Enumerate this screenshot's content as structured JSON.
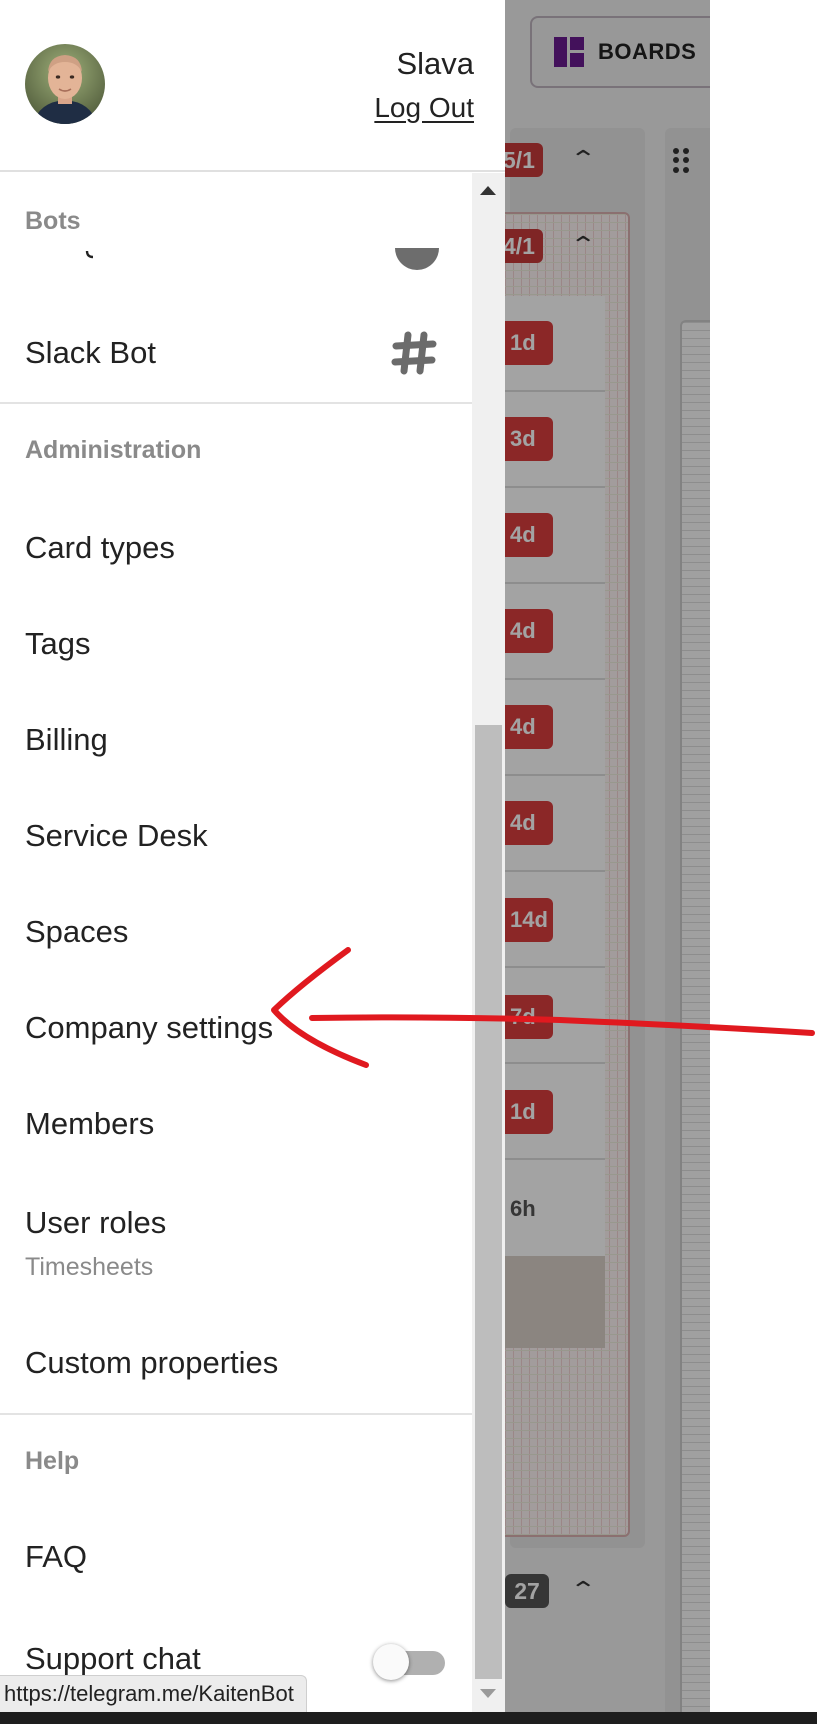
{
  "drawer": {
    "user_name": "Slava",
    "logout_label": "Log Out",
    "sections": {
      "bots": {
        "title": "Bots",
        "slack_bot_label": "Slack Bot"
      },
      "administration": {
        "title": "Administration",
        "items": [
          "Card types",
          "Tags",
          "Billing",
          "Service Desk",
          "Spaces",
          "Company settings",
          "Members",
          "User roles",
          "Custom properties"
        ],
        "sub_item": "Timesheets"
      },
      "help": {
        "title": "Help",
        "items": [
          "FAQ",
          "Support chat"
        ]
      }
    },
    "support_chat_toggle": "off"
  },
  "background": {
    "boards_button_label": "BOARDS",
    "column_counts": [
      "5/1",
      "4/1",
      "27"
    ],
    "card_chips": [
      "1d",
      "3d",
      "4d",
      "4d",
      "4d",
      "4d",
      "14d",
      "7d",
      "1d",
      "6h"
    ]
  },
  "status_bar": {
    "url": "https://telegram.me/KaitenBot"
  },
  "icons": {
    "slack_bot": "hash-icon",
    "boards": "dashboard-icon"
  },
  "colors": {
    "boards_icon": "#6a1b8f",
    "chip_red": "#d93d3d",
    "annotation_arrow": "#e0191f"
  }
}
